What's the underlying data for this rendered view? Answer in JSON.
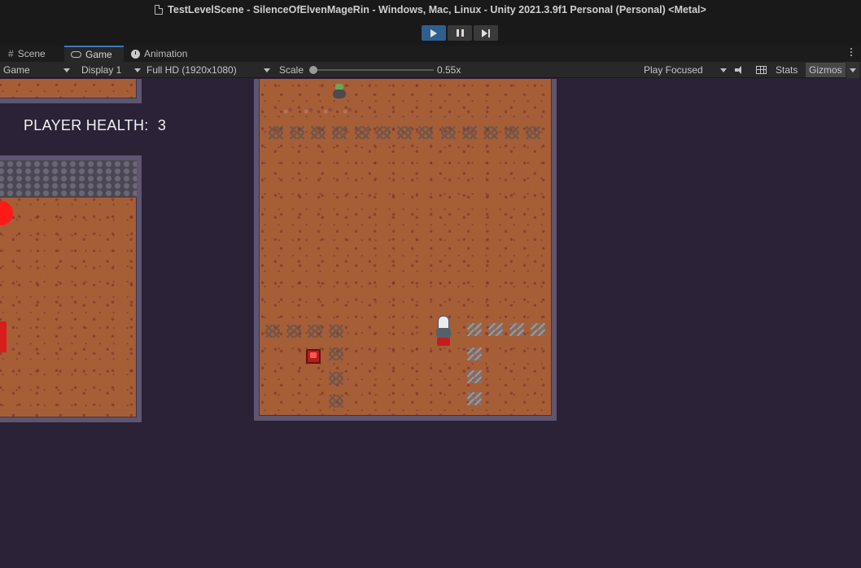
{
  "window": {
    "title": "TestLevelScene - SilenceOfElvenMageRin - Windows, Mac, Linux - Unity 2021.3.9f1 Personal (Personal) <Metal>"
  },
  "tabs": [
    {
      "label": "Scene",
      "icon": "hash-icon"
    },
    {
      "label": "Game",
      "icon": "gamepad-icon",
      "active": true
    },
    {
      "label": "Animation",
      "icon": "clock-icon"
    }
  ],
  "toolbar": {
    "view_mode": "Game",
    "display": "Display 1",
    "resolution": "Full HD (1920x1080)",
    "scale_label": "Scale",
    "scale_value": "0.55x",
    "play_mode": "Play Focused",
    "stats": "Stats",
    "gizmos": "Gizmos"
  },
  "game": {
    "hud_label": "PLAYER HEALTH:",
    "hud_value": "3"
  },
  "colors": {
    "accent": "#3a79bb",
    "background": "#2b2238",
    "floor": "#a65e37",
    "wall": "#5e5570"
  }
}
